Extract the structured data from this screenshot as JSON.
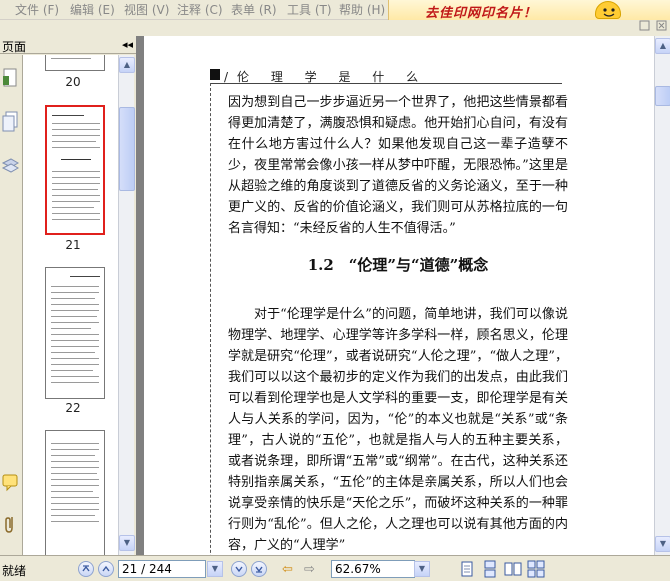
{
  "menu": {
    "items": [
      "文件 (F)",
      "编辑 (E)",
      "视图 (V)",
      "注释 (C)",
      "表单 (R)",
      "工具 (T)",
      "帮助 (H)"
    ]
  },
  "ad": {
    "text": "去佳印网印名片！"
  },
  "sidebar": {
    "title": "页面",
    "collapse_symbol": "◂◂",
    "thumbnails": [
      {
        "label": "20"
      },
      {
        "label": "21",
        "selected": true
      },
      {
        "label": "22"
      },
      {
        "label": ""
      }
    ]
  },
  "document": {
    "running_head": "伦 理 学 是 什 么",
    "running_head_prefix": "/",
    "paragraph1": "因为想到自己一步步逼近另一个世界了，他把这些情景都看得更加清楚了，满腹恐惧和疑虑。他开始扪心自问，有没有在什么地方害过什么人？如果他发现自己这一辈子造孽不少，夜里常常会像小孩一样从梦中吓醒，无限恐怖。”这里是从超验之维的角度谈到了道德反省的义务论涵义，至于一种更广义的、反省的价值论涵义，我们则可从苏格拉底的一句名言得知：“未经反省的人生不值得活。”",
    "section_heading": "1.2　“伦理”与“道德”概念",
    "paragraph2": "对于“伦理学是什么”的问题，简单地讲，我们可以像说物理学、地理学、心理学等许多学科一样，顾名思义，伦理学就是研究“伦理”，或者说研究“人伦之理”，“做人之理”，我们可以以这个最初步的定义作为我们的出发点，由此我们可以看到伦理学也是人文学科的重要一支，即伦理学是有关人与人关系的学问，因为，“伦”的本义也就是“关系”或“条理”，古人说的“五伦”，也就是指人与人的五种主要关系，或者说条理，即所谓“五常”或“纲常”。在古代，这种关系还特别指亲属关系，“五伦”的主体是亲属关系，所以人们也会说享受亲情的快乐是“天伦之乐”，而破坏这种关系的一种罪行则为“乱伦”。但人之伦，人之理也可以说有其他方面的内容，广义的“人理学”"
  },
  "statusbar": {
    "left_text": "就绪",
    "page_display": "21 / 244",
    "zoom": "62.67%"
  },
  "colors": {
    "chrome": "#ece9d8",
    "doc_background": "#808080",
    "selection": "#e0201c",
    "ad_text": "#c01818"
  }
}
